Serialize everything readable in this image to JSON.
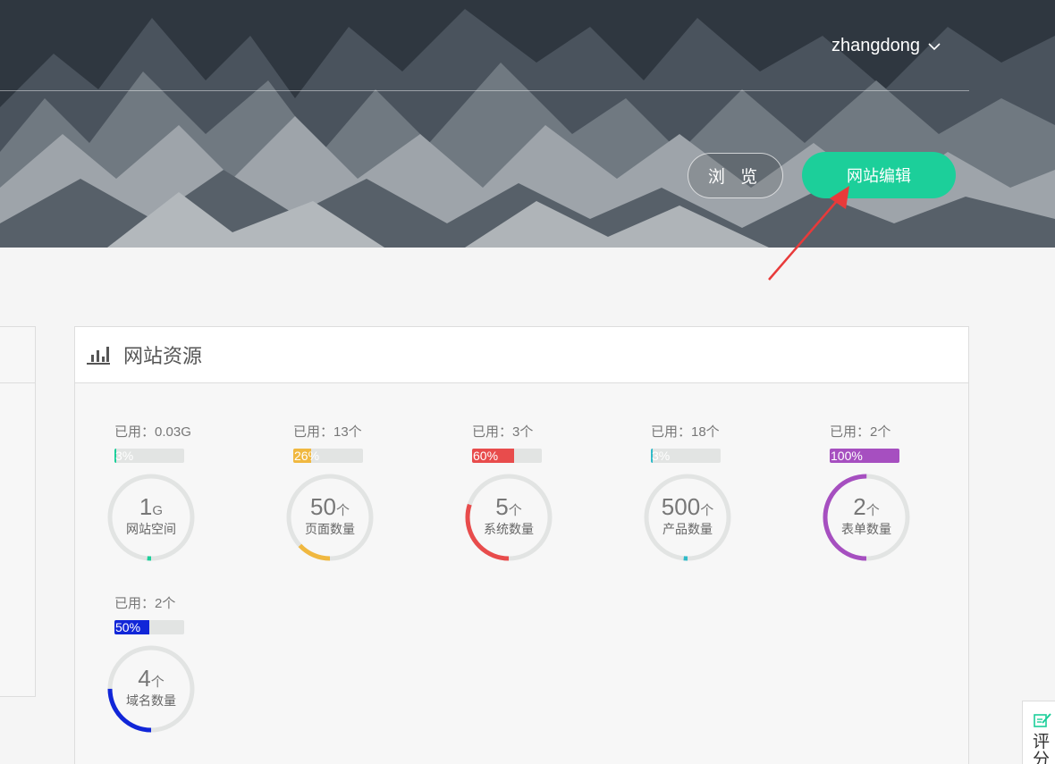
{
  "header": {
    "username": "zhangdong",
    "browse_label": "浏 览",
    "edit_label": "网站编辑"
  },
  "resources": {
    "title": "网站资源",
    "items": [
      {
        "used": "已用：0.03G",
        "percent": 3,
        "percent_text": "3%",
        "total": "1",
        "unit": "G",
        "label": "网站空间",
        "color": "#1ccf9a"
      },
      {
        "used": "已用：13个",
        "percent": 26,
        "percent_text": "26%",
        "total": "50",
        "unit": "个",
        "label": "页面数量",
        "color": "#f0b840"
      },
      {
        "used": "已用：3个",
        "percent": 60,
        "percent_text": "60%",
        "total": "5",
        "unit": "个",
        "label": "系统数量",
        "color": "#e84c4c"
      },
      {
        "used": "已用：18个",
        "percent": 3,
        "percent_text": "3%",
        "total": "500",
        "unit": "个",
        "label": "产品数量",
        "color": "#2fbac8"
      },
      {
        "used": "已用：2个",
        "percent": 100,
        "percent_text": "100%",
        "total": "2",
        "unit": "个",
        "label": "表单数量",
        "color": "#a64fc0"
      },
      {
        "used": "已用：2个",
        "percent": 50,
        "percent_text": "50%",
        "total": "4",
        "unit": "个",
        "label": "域名数量",
        "color": "#1126d8"
      }
    ]
  },
  "rating": {
    "label": "评分"
  },
  "colors": {
    "accent": "#1ccf9a",
    "track": "#e2e4e3"
  }
}
